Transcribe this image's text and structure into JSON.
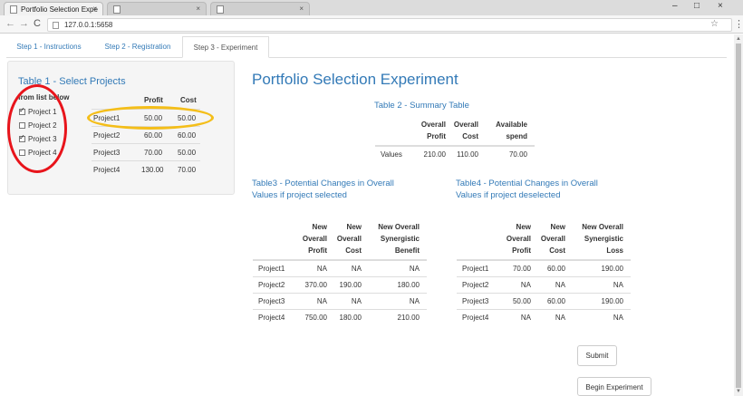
{
  "browser": {
    "tabs": [
      {
        "title": "Portfolio Selection Expe",
        "close": "×"
      },
      {
        "title": "",
        "close": "×"
      },
      {
        "title": "",
        "close": "×"
      }
    ],
    "window_controls": [
      "–",
      "□",
      "×"
    ],
    "nav": {
      "back": "←",
      "forward": "→",
      "reload": "C"
    },
    "url": "127.0.0.1:5658",
    "star_icon": "☆",
    "menu_icon": "⋮"
  },
  "nav_tabs": [
    "Step 1 - Instructions",
    "Step 2 - Registration",
    "Step 3 - Experiment"
  ],
  "sidebar": {
    "heading": "Table 1 - Select Projects",
    "from_list": "from list below",
    "checkboxes": [
      {
        "label": "Project 1",
        "checked": true
      },
      {
        "label": "Project 2",
        "checked": false
      },
      {
        "label": "Project 3",
        "checked": true
      },
      {
        "label": "Project 4",
        "checked": false
      }
    ],
    "col_profit": "Profit",
    "col_cost": "Cost",
    "rows": [
      {
        "name": "Project1",
        "profit": "50.00",
        "cost": "50.00"
      },
      {
        "name": "Project2",
        "profit": "60.00",
        "cost": "60.00"
      },
      {
        "name": "Project3",
        "profit": "70.00",
        "cost": "50.00"
      },
      {
        "name": "Project4",
        "profit": "130.00",
        "cost": "70.00"
      }
    ]
  },
  "main": {
    "title": "Portfolio Selection Experiment",
    "summary": {
      "caption": "Table 2 - Summary Table",
      "headers": [
        "Overall Profit",
        "Overall Cost",
        "Available spend"
      ],
      "row_label": "Values",
      "values": [
        "210.00",
        "110.00",
        "70.00"
      ]
    },
    "table3": {
      "caption": "Table3 - Potential Changes in Overall Values if project selected",
      "headers": [
        "New Overall Profit",
        "New Overall Cost",
        "New Overall Synergistic Benefit"
      ],
      "rows": [
        {
          "name": "Project1",
          "v": [
            "NA",
            "NA",
            "NA"
          ]
        },
        {
          "name": "Project2",
          "v": [
            "370.00",
            "190.00",
            "180.00"
          ]
        },
        {
          "name": "Project3",
          "v": [
            "NA",
            "NA",
            "NA"
          ]
        },
        {
          "name": "Project4",
          "v": [
            "750.00",
            "180.00",
            "210.00"
          ]
        }
      ]
    },
    "table4": {
      "caption": "Table4 - Potential Changes in Overall Values if project deselected",
      "headers": [
        "New Overall Profit",
        "New Overall Cost",
        "New Overall Synergistic Loss"
      ],
      "rows": [
        {
          "name": "Project1",
          "v": [
            "70.00",
            "60.00",
            "190.00"
          ]
        },
        {
          "name": "Project2",
          "v": [
            "NA",
            "NA",
            "NA"
          ]
        },
        {
          "name": "Project3",
          "v": [
            "50.00",
            "60.00",
            "190.00"
          ]
        },
        {
          "name": "Project4",
          "v": [
            "NA",
            "NA",
            "NA"
          ]
        }
      ]
    },
    "submit": "Submit",
    "begin": "Begin Experiment"
  },
  "colors": {
    "link": "#337ab7",
    "annotation_red": "#e8141b",
    "annotation_yellow": "#f4be19"
  }
}
